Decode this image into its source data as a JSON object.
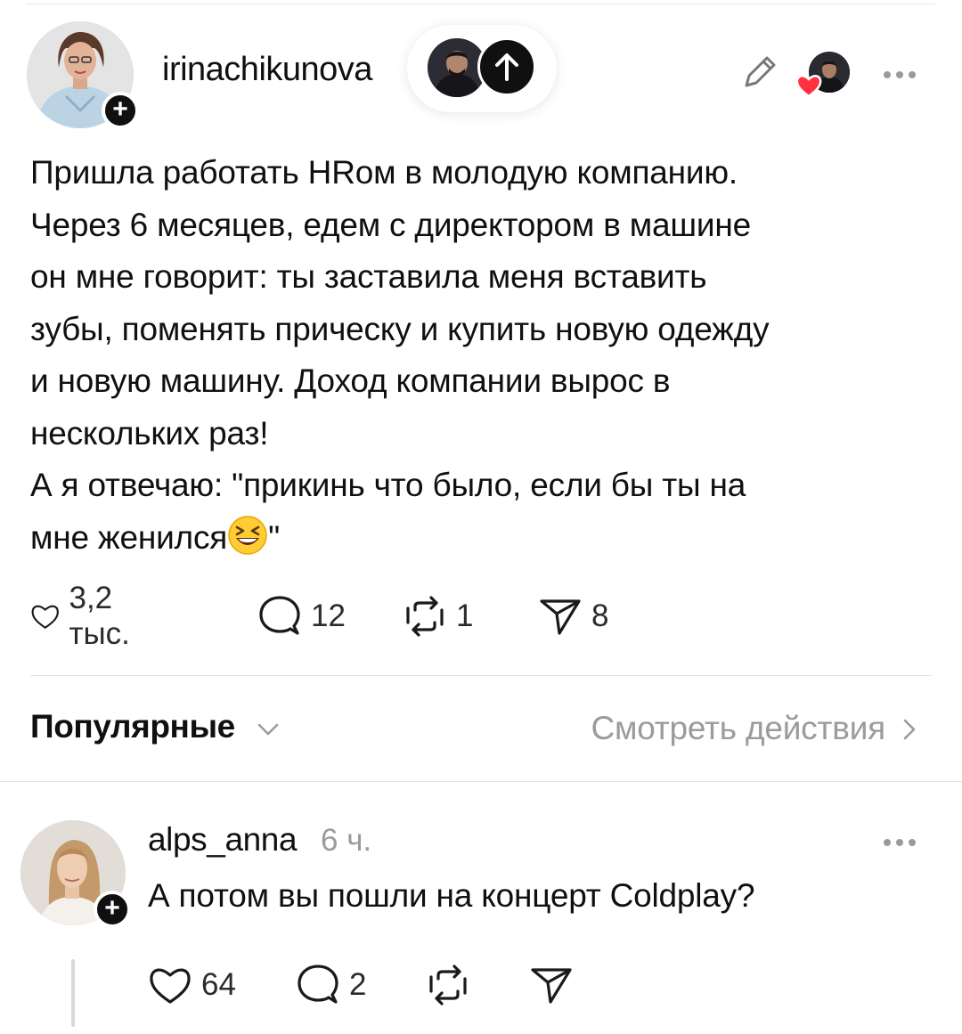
{
  "post": {
    "username": "irinachikunova",
    "body_lines": [
      "Пришла работать HRом в молодую компанию.",
      "Через 6 месяцев, едем с директором в машине",
      "он мне говорит: ты заставила меня вставить",
      "зубы, поменять прическу и купить новую одежду",
      "и новую машину. Доход компании вырос в",
      "нескольких раз!",
      "А я отвечаю: \"прикинь что было, если бы ты на",
      "мне женился"
    ],
    "body_last_suffix": "\"",
    "emoji": "grinning-squinting-face",
    "follow_symbol": "+",
    "actions": {
      "likes": "3,2 тыс.",
      "comments": "12",
      "reposts": "1",
      "shares": "8"
    }
  },
  "sort": {
    "label": "Популярные",
    "view_actions": "Смотреть действия"
  },
  "reply": {
    "username": "alps_anna",
    "time": "6 ч.",
    "text": "А потом вы пошли на концерт Coldplay?",
    "follow_symbol": "+",
    "actions": {
      "likes": "64",
      "comments": "2"
    }
  },
  "icons": {
    "like": "heart-outline-icon",
    "comment": "speech-bubble-icon",
    "repost": "repost-icon",
    "share": "send-icon",
    "edit": "pencil-icon",
    "more": "more-dots-icon",
    "boost": "arrow-up-icon",
    "heart_badge": "heart-filled-icon"
  },
  "colors": {
    "text": "#101010",
    "muted": "#9b9b9b",
    "heart_badge": "#ff3040",
    "divider": "#e3e3e3"
  }
}
